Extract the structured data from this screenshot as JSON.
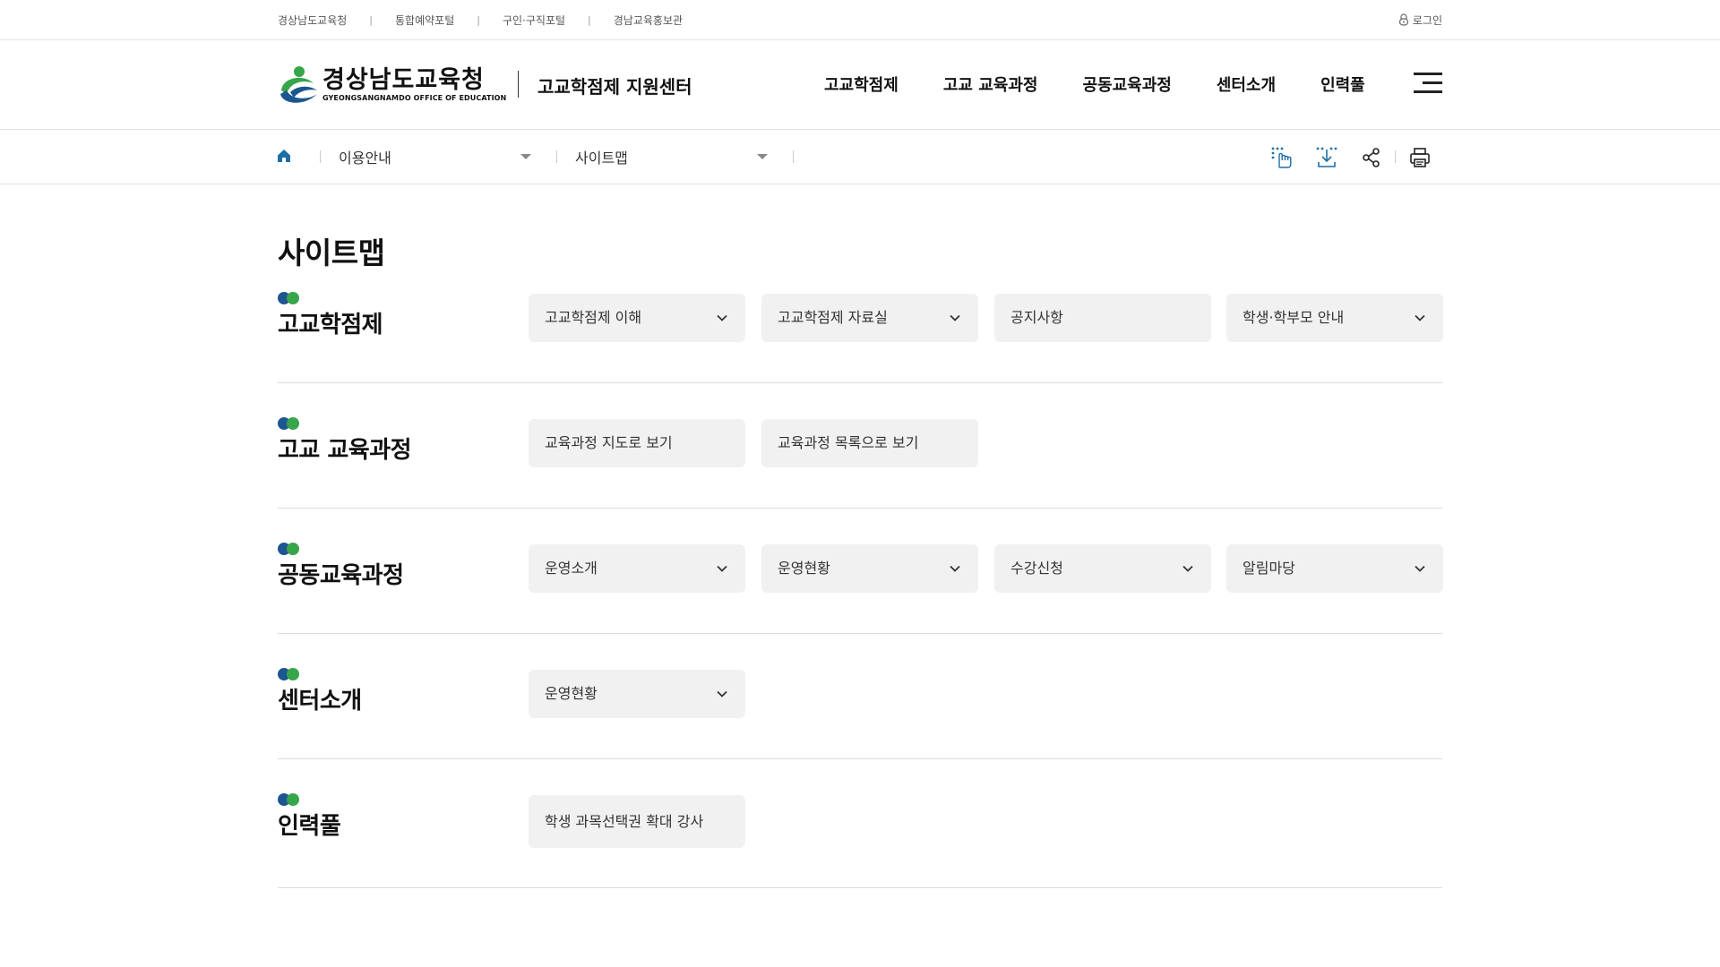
{
  "topbar": {
    "links": [
      "경상남도교육청",
      "통합예약포털",
      "구인·구직포털",
      "경남교육홍보관"
    ],
    "separator": "|",
    "login": "로그인"
  },
  "header": {
    "logo_ko": "경상남도교육청",
    "logo_en": "GYEONGSANGNAMDO OFFICE OF EDUCATION",
    "center_name": "고교학점제 지원센터",
    "nav": [
      "고교학점제",
      "고교 교육과정",
      "공동교육과정",
      "센터소개",
      "인력풀"
    ]
  },
  "breadcrumb": {
    "level1": "이용안내",
    "level2": "사이트맵"
  },
  "page": {
    "title": "사이트맵"
  },
  "sections": [
    {
      "title": "고교학점제",
      "items": [
        {
          "label": "고교학점제 이해",
          "dropdown": true
        },
        {
          "label": "고교학점제 자료실",
          "dropdown": true
        },
        {
          "label": "공지사항",
          "dropdown": false
        },
        {
          "label": "학생·학부모 안내",
          "dropdown": true
        }
      ]
    },
    {
      "title": "고교 교육과정",
      "items": [
        {
          "label": "교육과정 지도로 보기",
          "dropdown": false
        },
        {
          "label": "교육과정 목록으로 보기",
          "dropdown": false
        }
      ]
    },
    {
      "title": "공동교육과정",
      "items": [
        {
          "label": "운영소개",
          "dropdown": true
        },
        {
          "label": "운영현황",
          "dropdown": true
        },
        {
          "label": "수강신청",
          "dropdown": true
        },
        {
          "label": "알림마당",
          "dropdown": true
        }
      ]
    },
    {
      "title": "센터소개",
      "items": [
        {
          "label": "운영현황",
          "dropdown": true
        }
      ]
    },
    {
      "title": "인력풀",
      "items": [
        {
          "label": "학생 과목선택권 확대 강사",
          "dropdown": false
        }
      ]
    }
  ],
  "colors": {
    "dot_dark": "#1c5690",
    "dot_green": "#37a54a",
    "home_icon": "#1d6fa8",
    "button_bg": "#f1f1f1"
  },
  "icons": [
    "lock-icon",
    "home-icon",
    "hand-pointer-icon",
    "download-icon",
    "share-icon",
    "print-icon",
    "chevron-down-icon",
    "hamburger-menu-icon"
  ]
}
